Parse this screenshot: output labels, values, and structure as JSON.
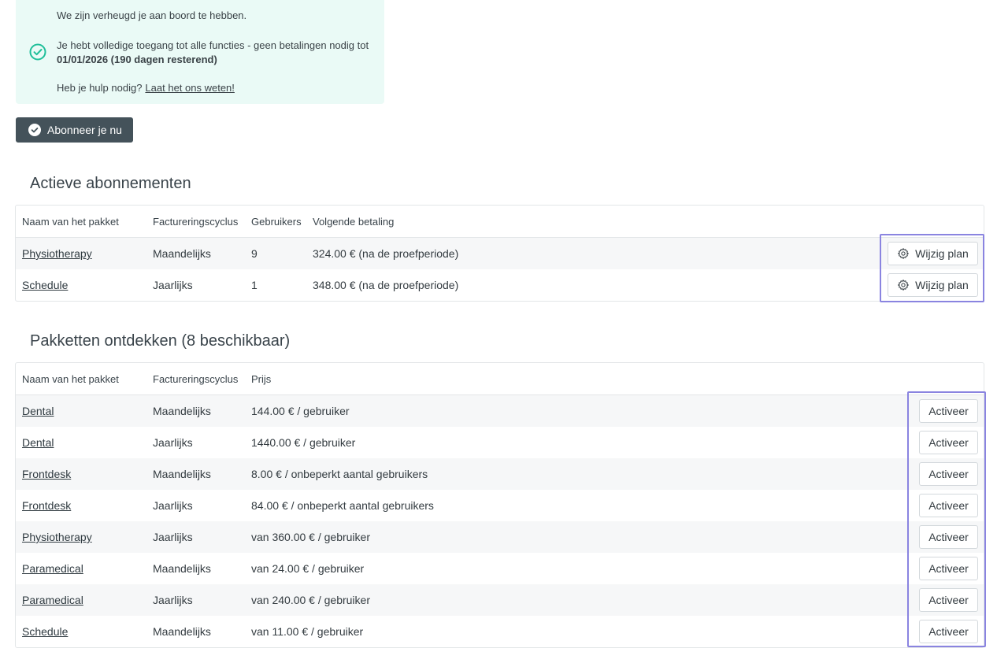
{
  "notice": {
    "line1": "We zijn verheugd je aan boord te hebben.",
    "line2": "Je hebt volledige toegang tot alle functies - geen betalingen nodig tot",
    "line3": "01/01/2026 (190 dagen resterend)",
    "help_text": "Heb je hulp nodig?",
    "help_link": "Laat het ons weten!",
    "accent_color": "#1fbf9a"
  },
  "subscribe_button": "Abonneer je nu",
  "active": {
    "title": "Actieve abonnementen",
    "headers": [
      "Naam van het pakket",
      "Factureringscyclus",
      "Gebruikers",
      "Volgende betaling"
    ],
    "action_label": "Wijzig plan",
    "rows": [
      {
        "name": "Physiotherapy",
        "cycle": "Maandelijks",
        "users": "9",
        "next": "324.00 € (na de proefperiode)"
      },
      {
        "name": "Schedule",
        "cycle": "Jaarlijks",
        "users": "1",
        "next": "348.00 € (na de proefperiode)"
      }
    ]
  },
  "discover": {
    "title": "Pakketten ontdekken (8 beschikbaar)",
    "headers": [
      "Naam van het pakket",
      "Factureringscyclus",
      "Prijs"
    ],
    "action_label": "Activeer",
    "rows": [
      {
        "name": "Dental",
        "cycle": "Maandelijks",
        "price": "144.00 € / gebruiker"
      },
      {
        "name": "Dental",
        "cycle": "Jaarlijks",
        "price": "1440.00 € / gebruiker"
      },
      {
        "name": "Frontdesk",
        "cycle": "Maandelijks",
        "price": "8.00 € / onbeperkt aantal gebruikers"
      },
      {
        "name": "Frontdesk",
        "cycle": "Jaarlijks",
        "price": "84.00 € / onbeperkt aantal gebruikers"
      },
      {
        "name": "Physiotherapy",
        "cycle": "Jaarlijks",
        "price": "van 360.00 € / gebruiker"
      },
      {
        "name": "Paramedical",
        "cycle": "Maandelijks",
        "price": "van 24.00 € / gebruiker"
      },
      {
        "name": "Paramedical",
        "cycle": "Jaarlijks",
        "price": "van 240.00 € / gebruiker"
      },
      {
        "name": "Schedule",
        "cycle": "Maandelijks",
        "price": "van 11.00 € / gebruiker"
      }
    ]
  }
}
